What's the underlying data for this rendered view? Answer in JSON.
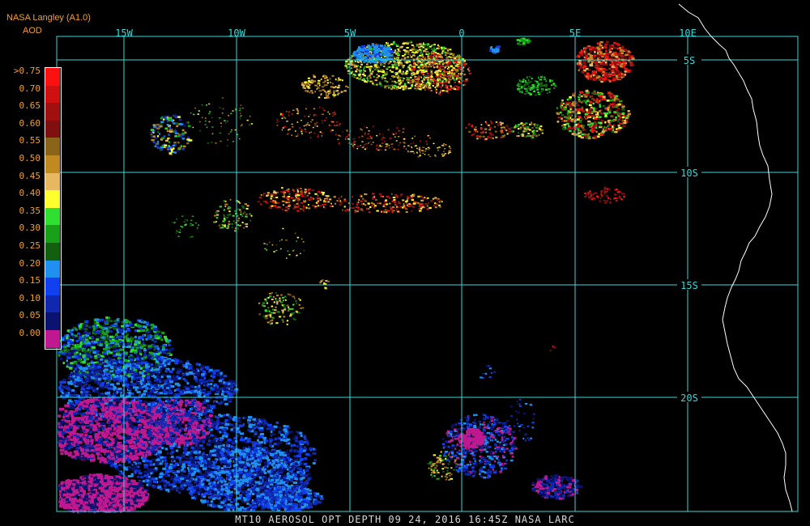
{
  "header": {
    "title": "NASA Langley (A1.0)",
    "subtitle": "AOD"
  },
  "footer": {
    "text": "MT10  AEROSOL OPT DEPTH   09 24, 2016 16:45Z   NASA LARC"
  },
  "map": {
    "lon_labels": [
      "15W",
      "10W",
      "5W",
      "0",
      "5E",
      "10E"
    ],
    "lat_labels": [
      "5S",
      "10S",
      "15S",
      "20S"
    ],
    "grid_color": "#38d8d8",
    "coast_color": "#ffffff",
    "background": "#000000"
  },
  "legend": {
    "items": [
      {
        "label": ">0.75",
        "color": "#ff1010"
      },
      {
        "label": "0.70",
        "color": "#d01010"
      },
      {
        "label": "0.65",
        "color": "#a01010"
      },
      {
        "label": "0.60",
        "color": "#801010"
      },
      {
        "label": "0.55",
        "color": "#8a6418"
      },
      {
        "label": "0.50",
        "color": "#c08a20"
      },
      {
        "label": "0.45",
        "color": "#e8b860"
      },
      {
        "label": "0.40",
        "color": "#ffff30"
      },
      {
        "label": "0.35",
        "color": "#30e030"
      },
      {
        "label": "0.30",
        "color": "#18a018"
      },
      {
        "label": "0.25",
        "color": "#106010"
      },
      {
        "label": "0.20",
        "color": "#2090f0"
      },
      {
        "label": "0.15",
        "color": "#1040f0"
      },
      {
        "label": "0.10",
        "color": "#1028b0"
      },
      {
        "label": "0.05",
        "color": "#0a1470"
      },
      {
        "label": "0.00",
        "color": "#c01890"
      }
    ]
  }
}
